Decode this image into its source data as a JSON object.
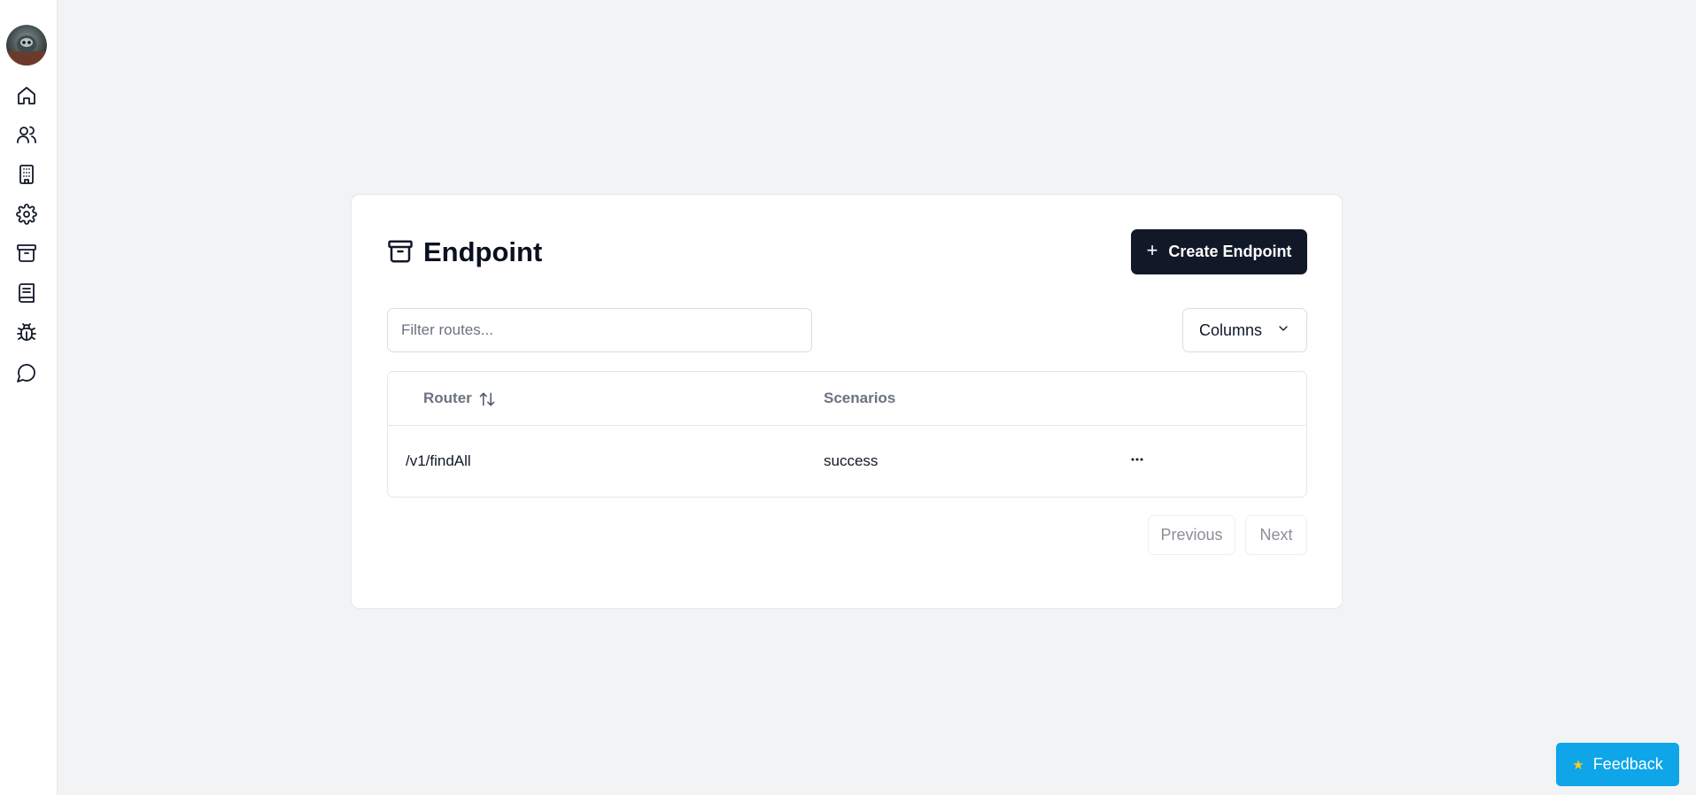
{
  "sidebar": {
    "items": [
      {
        "name": "home-icon"
      },
      {
        "name": "users-icon"
      },
      {
        "name": "building-icon"
      },
      {
        "name": "gear-icon"
      },
      {
        "name": "archive-icon"
      },
      {
        "name": "book-icon"
      },
      {
        "name": "bug-icon"
      },
      {
        "name": "chat-icon"
      }
    ]
  },
  "page": {
    "title": "Endpoint",
    "title_icon": "archive-icon",
    "create_button": "Create Endpoint"
  },
  "filter": {
    "placeholder": "Filter routes...",
    "value": ""
  },
  "columns_button": "Columns",
  "table": {
    "headers": [
      "Router",
      "Scenarios"
    ],
    "rows": [
      {
        "router": "/v1/findAll",
        "scenarios": "success"
      }
    ]
  },
  "pagination": {
    "previous": "Previous",
    "next": "Next"
  },
  "feedback_button": "Feedback",
  "colors": {
    "primary": "#111827",
    "feedback": "#0ea5e9",
    "background": "#f2f3f5"
  }
}
